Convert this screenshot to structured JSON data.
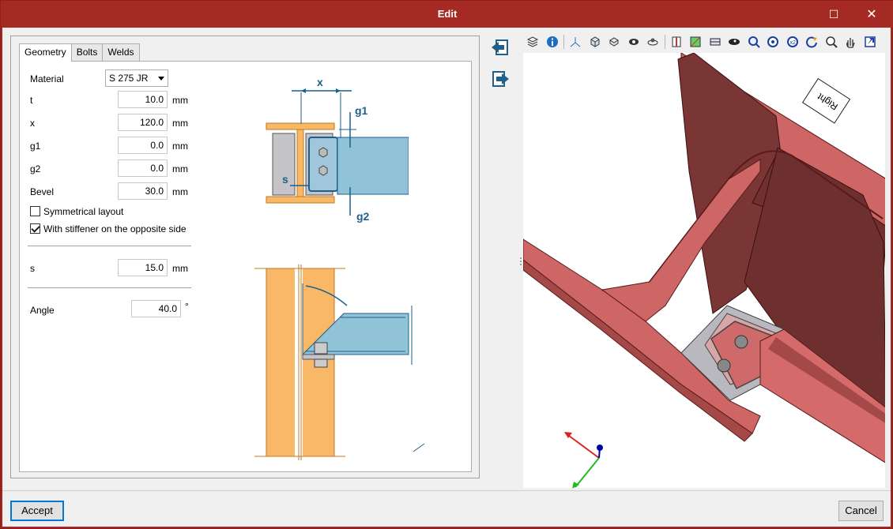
{
  "window": {
    "title": "Edit"
  },
  "tabs": [
    "Geometry",
    "Bolts",
    "Welds"
  ],
  "form": {
    "material_label": "Material",
    "material_value": "S 275 JR",
    "t_label": "t",
    "t_value": "10.0",
    "x_label": "x",
    "x_value": "120.0",
    "g1_label": "g1",
    "g1_value": "0.0",
    "g2_label": "g2",
    "g2_value": "0.0",
    "bevel_label": "Bevel",
    "bevel_value": "30.0",
    "unit_mm": "mm",
    "symmetrical_label": "Symmetrical layout",
    "symmetrical_checked": false,
    "stiffener_label": "With stiffener on the opposite side",
    "stiffener_checked": true,
    "s_label": "s",
    "s_value": "15.0",
    "angle_label": "Angle",
    "angle_value": "40.0",
    "unit_deg": "°"
  },
  "drawing_labels": {
    "x": "x",
    "g1": "g1",
    "g2": "g2",
    "s": "s"
  },
  "view_cube_label": "Right",
  "footer": {
    "accept": "Accept",
    "cancel": "Cancel"
  },
  "colors": {
    "titlebar": "#a62a24",
    "beam_red": "#cf6666",
    "column_orange": "#f9b868",
    "beam_blue": "#90c3d8",
    "accent_blue": "#0078d7"
  },
  "toolbar_icons": [
    "layers-icon",
    "info-icon",
    "axes-icon",
    "cube-view-icon",
    "views-icon",
    "eye-render-icon",
    "orbit-icon",
    "section-icon",
    "wireframe-icon",
    "hide-icon",
    "visibility-icon",
    "zoom-window-icon",
    "zoom-extents-icon",
    "zoom-out-icon",
    "rotate-icon",
    "zoom-icon",
    "pan-icon",
    "export-icon"
  ]
}
